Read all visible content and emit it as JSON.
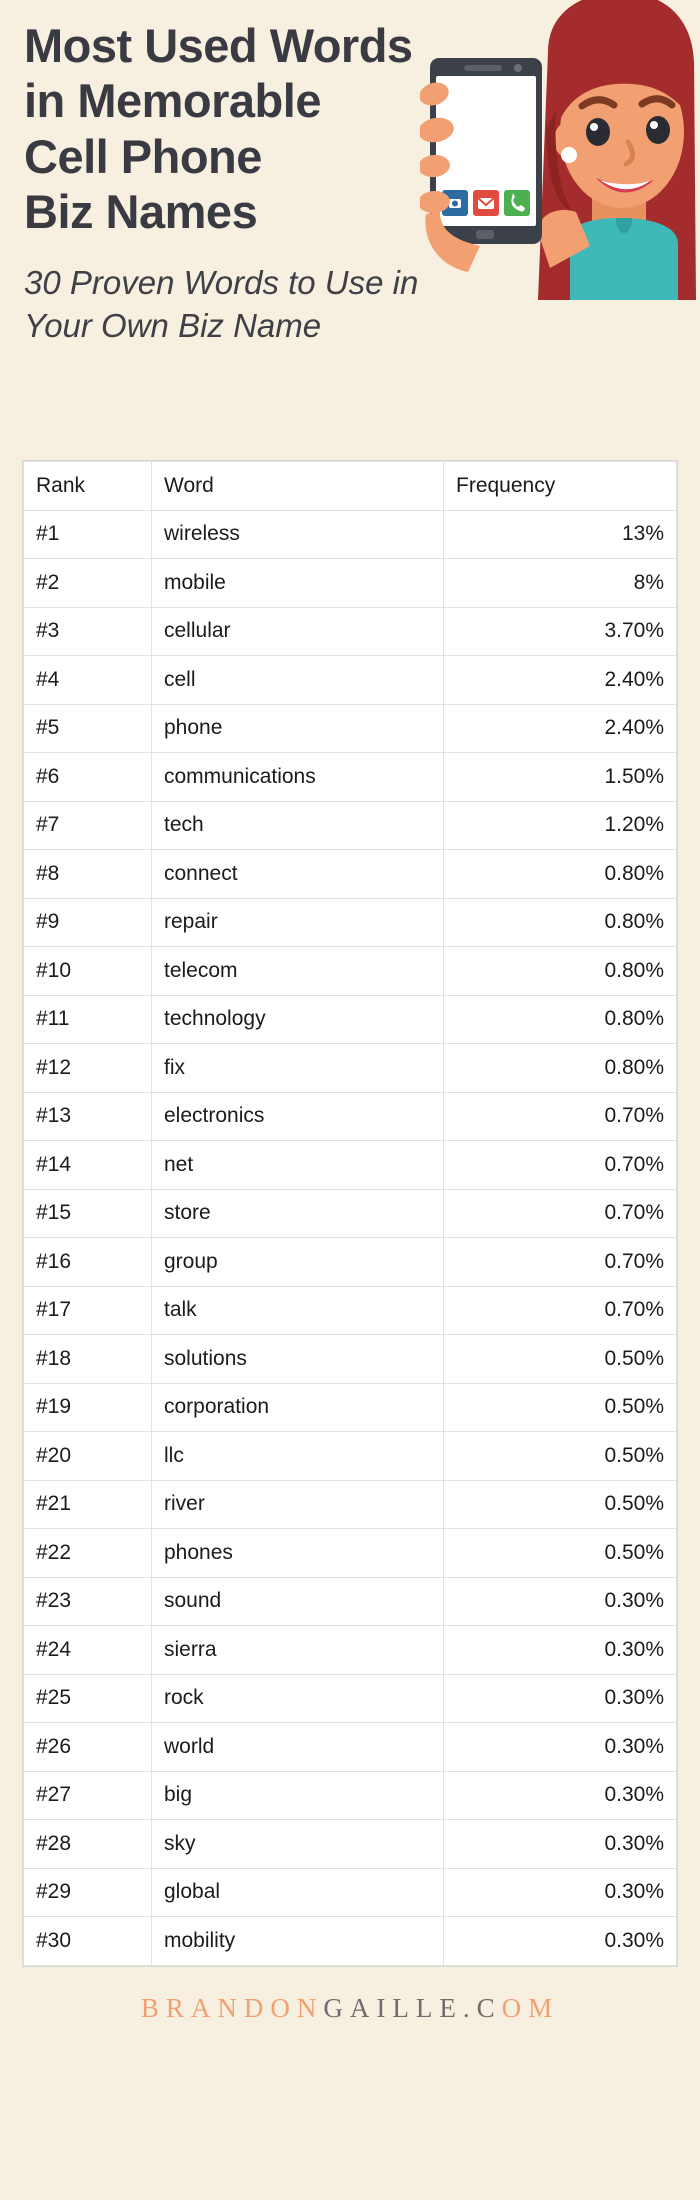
{
  "header": {
    "title_lines": [
      "Most Used Words",
      "in Memorable",
      "Cell Phone",
      "Biz Names"
    ],
    "subtitle_lines": [
      "30 Proven Words to Use in",
      "Your Own Biz Name"
    ]
  },
  "illustration": {
    "name": "woman-holding-smartphone",
    "skin_color": "#f2a072",
    "hair_color": "#a42c2c",
    "shirt_color": "#3fb8b8",
    "phone_body_color": "#3c4048",
    "phone_screen_color": "#ffffff",
    "app_icons": [
      "camera-app-icon",
      "mail-app-icon",
      "phone-app-icon"
    ],
    "app_icon_colors": [
      "#2d6ca2",
      "#e04a3f",
      "#4caf50"
    ]
  },
  "table": {
    "columns": [
      "Rank",
      "Word",
      "Frequency"
    ],
    "rows": [
      {
        "rank": "#1",
        "word": "wireless",
        "frequency": "13%"
      },
      {
        "rank": "#2",
        "word": "mobile",
        "frequency": "8%"
      },
      {
        "rank": "#3",
        "word": "cellular",
        "frequency": "3.70%"
      },
      {
        "rank": "#4",
        "word": "cell",
        "frequency": "2.40%"
      },
      {
        "rank": "#5",
        "word": "phone",
        "frequency": "2.40%"
      },
      {
        "rank": "#6",
        "word": "communications",
        "frequency": "1.50%"
      },
      {
        "rank": "#7",
        "word": "tech",
        "frequency": "1.20%"
      },
      {
        "rank": "#8",
        "word": "connect",
        "frequency": "0.80%"
      },
      {
        "rank": "#9",
        "word": "repair",
        "frequency": "0.80%"
      },
      {
        "rank": "#10",
        "word": "telecom",
        "frequency": "0.80%"
      },
      {
        "rank": "#11",
        "word": "technology",
        "frequency": "0.80%"
      },
      {
        "rank": "#12",
        "word": "fix",
        "frequency": "0.80%"
      },
      {
        "rank": "#13",
        "word": "electronics",
        "frequency": "0.70%"
      },
      {
        "rank": "#14",
        "word": "net",
        "frequency": "0.70%"
      },
      {
        "rank": "#15",
        "word": "store",
        "frequency": "0.70%"
      },
      {
        "rank": "#16",
        "word": "group",
        "frequency": "0.70%"
      },
      {
        "rank": "#17",
        "word": "talk",
        "frequency": "0.70%"
      },
      {
        "rank": "#18",
        "word": "solutions",
        "frequency": "0.50%"
      },
      {
        "rank": "#19",
        "word": "corporation",
        "frequency": "0.50%"
      },
      {
        "rank": "#20",
        "word": "llc",
        "frequency": "0.50%"
      },
      {
        "rank": "#21",
        "word": "river",
        "frequency": "0.50%"
      },
      {
        "rank": "#22",
        "word": "phones",
        "frequency": "0.50%"
      },
      {
        "rank": "#23",
        "word": "sound",
        "frequency": "0.30%"
      },
      {
        "rank": "#24",
        "word": "sierra",
        "frequency": "0.30%"
      },
      {
        "rank": "#25",
        "word": "rock",
        "frequency": "0.30%"
      },
      {
        "rank": "#26",
        "word": "world",
        "frequency": "0.30%"
      },
      {
        "rank": "#27",
        "word": "big",
        "frequency": "0.30%"
      },
      {
        "rank": "#28",
        "word": "sky",
        "frequency": "0.30%"
      },
      {
        "rank": "#29",
        "word": "global",
        "frequency": "0.30%"
      },
      {
        "rank": "#30",
        "word": "mobility",
        "frequency": "0.30%"
      }
    ]
  },
  "footer": {
    "part_one": "BRANDON",
    "part_two": "GAILLE.C",
    "part_three": "OM",
    "brand_orange": "#f2a071",
    "brand_gray": "#6d6d6d"
  },
  "colors": {
    "background": "#f7f0e0",
    "text_dark": "#3a3a42",
    "table_bg": "#ffffff",
    "table_border": "#e2e2e2"
  },
  "chart_data": {
    "type": "table",
    "title": "Most Used Words in Memorable Cell Phone Biz Names",
    "subtitle": "30 Proven Words to Use in Your Own Biz Name",
    "columns": [
      "Rank",
      "Word",
      "Frequency"
    ],
    "categories": [
      "wireless",
      "mobile",
      "cellular",
      "cell",
      "phone",
      "communications",
      "tech",
      "connect",
      "repair",
      "telecom",
      "technology",
      "fix",
      "electronics",
      "net",
      "store",
      "group",
      "talk",
      "solutions",
      "corporation",
      "llc",
      "river",
      "phones",
      "sound",
      "sierra",
      "rock",
      "world",
      "big",
      "sky",
      "global",
      "mobility"
    ],
    "values": [
      13,
      8,
      3.7,
      2.4,
      2.4,
      1.5,
      1.2,
      0.8,
      0.8,
      0.8,
      0.8,
      0.8,
      0.7,
      0.7,
      0.7,
      0.7,
      0.7,
      0.5,
      0.5,
      0.5,
      0.5,
      0.5,
      0.3,
      0.3,
      0.3,
      0.3,
      0.3,
      0.3,
      0.3,
      0.3
    ],
    "ylabel": "Frequency (%)",
    "xlabel": "Word"
  }
}
